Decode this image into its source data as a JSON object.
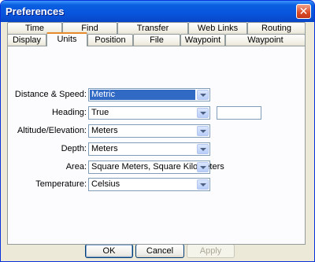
{
  "window": {
    "title": "Preferences"
  },
  "tabs_back": [
    {
      "label": "Time"
    },
    {
      "label": "Find"
    },
    {
      "label": "Transfer"
    },
    {
      "label": "Web Links"
    },
    {
      "label": "Routing"
    }
  ],
  "tabs_front": [
    {
      "label": "Display"
    },
    {
      "label": "Units"
    },
    {
      "label": "Position"
    },
    {
      "label": "File Location"
    },
    {
      "label": "Waypoint"
    },
    {
      "label": "Waypoint Categories"
    }
  ],
  "active_tab": "Units",
  "fields": [
    {
      "label": "Distance & Speed:",
      "value": "Metric"
    },
    {
      "label": "Heading:",
      "value": "True"
    },
    {
      "label": "Altitude/Elevation:",
      "value": "Meters"
    },
    {
      "label": "Depth:",
      "value": "Meters"
    },
    {
      "label": "Area:",
      "value": "Square Meters, Square Kilometers"
    },
    {
      "label": "Temperature:",
      "value": "Celsius"
    }
  ],
  "heading_extra": {
    "value": ""
  },
  "buttons": {
    "ok": "OK",
    "cancel": "Cancel",
    "apply": "Apply"
  }
}
